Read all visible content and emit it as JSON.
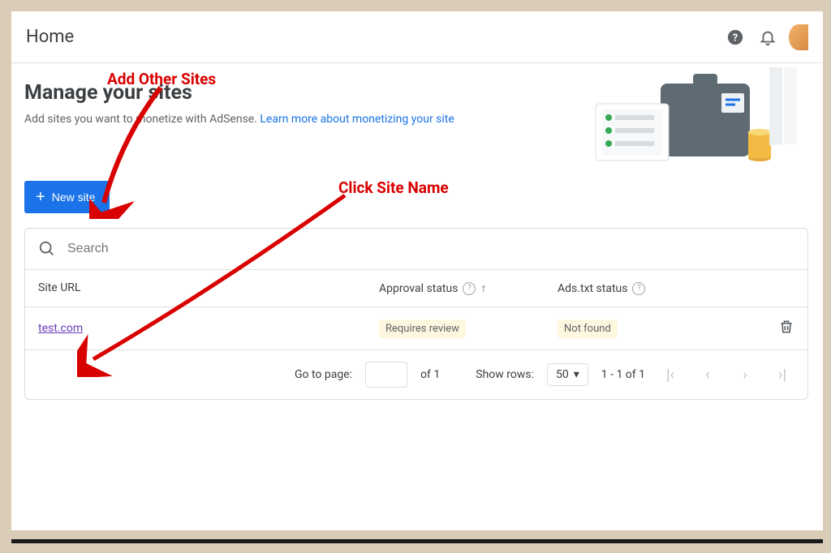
{
  "header": {
    "title": "Home"
  },
  "page": {
    "title": "Manage your sites",
    "subtitle_text": "Add sites you want to monetize with AdSense. ",
    "subtitle_link": "Learn more about monetizing your site"
  },
  "buttons": {
    "new_site": "New site"
  },
  "search": {
    "placeholder": "Search"
  },
  "table": {
    "headers": {
      "url": "Site URL",
      "approval": "Approval status",
      "ads": "Ads.txt status"
    },
    "rows": [
      {
        "url": "test.com",
        "approval": "Requires review",
        "ads": "Not found"
      }
    ]
  },
  "pagination": {
    "goto_label": "Go to page:",
    "of_label": "of 1",
    "rows_label": "Show rows:",
    "rows_value": "50",
    "range": "1 - 1 of 1"
  },
  "annotations": {
    "add_sites": "Add Other Sites",
    "click_name": "Click Site Name"
  }
}
